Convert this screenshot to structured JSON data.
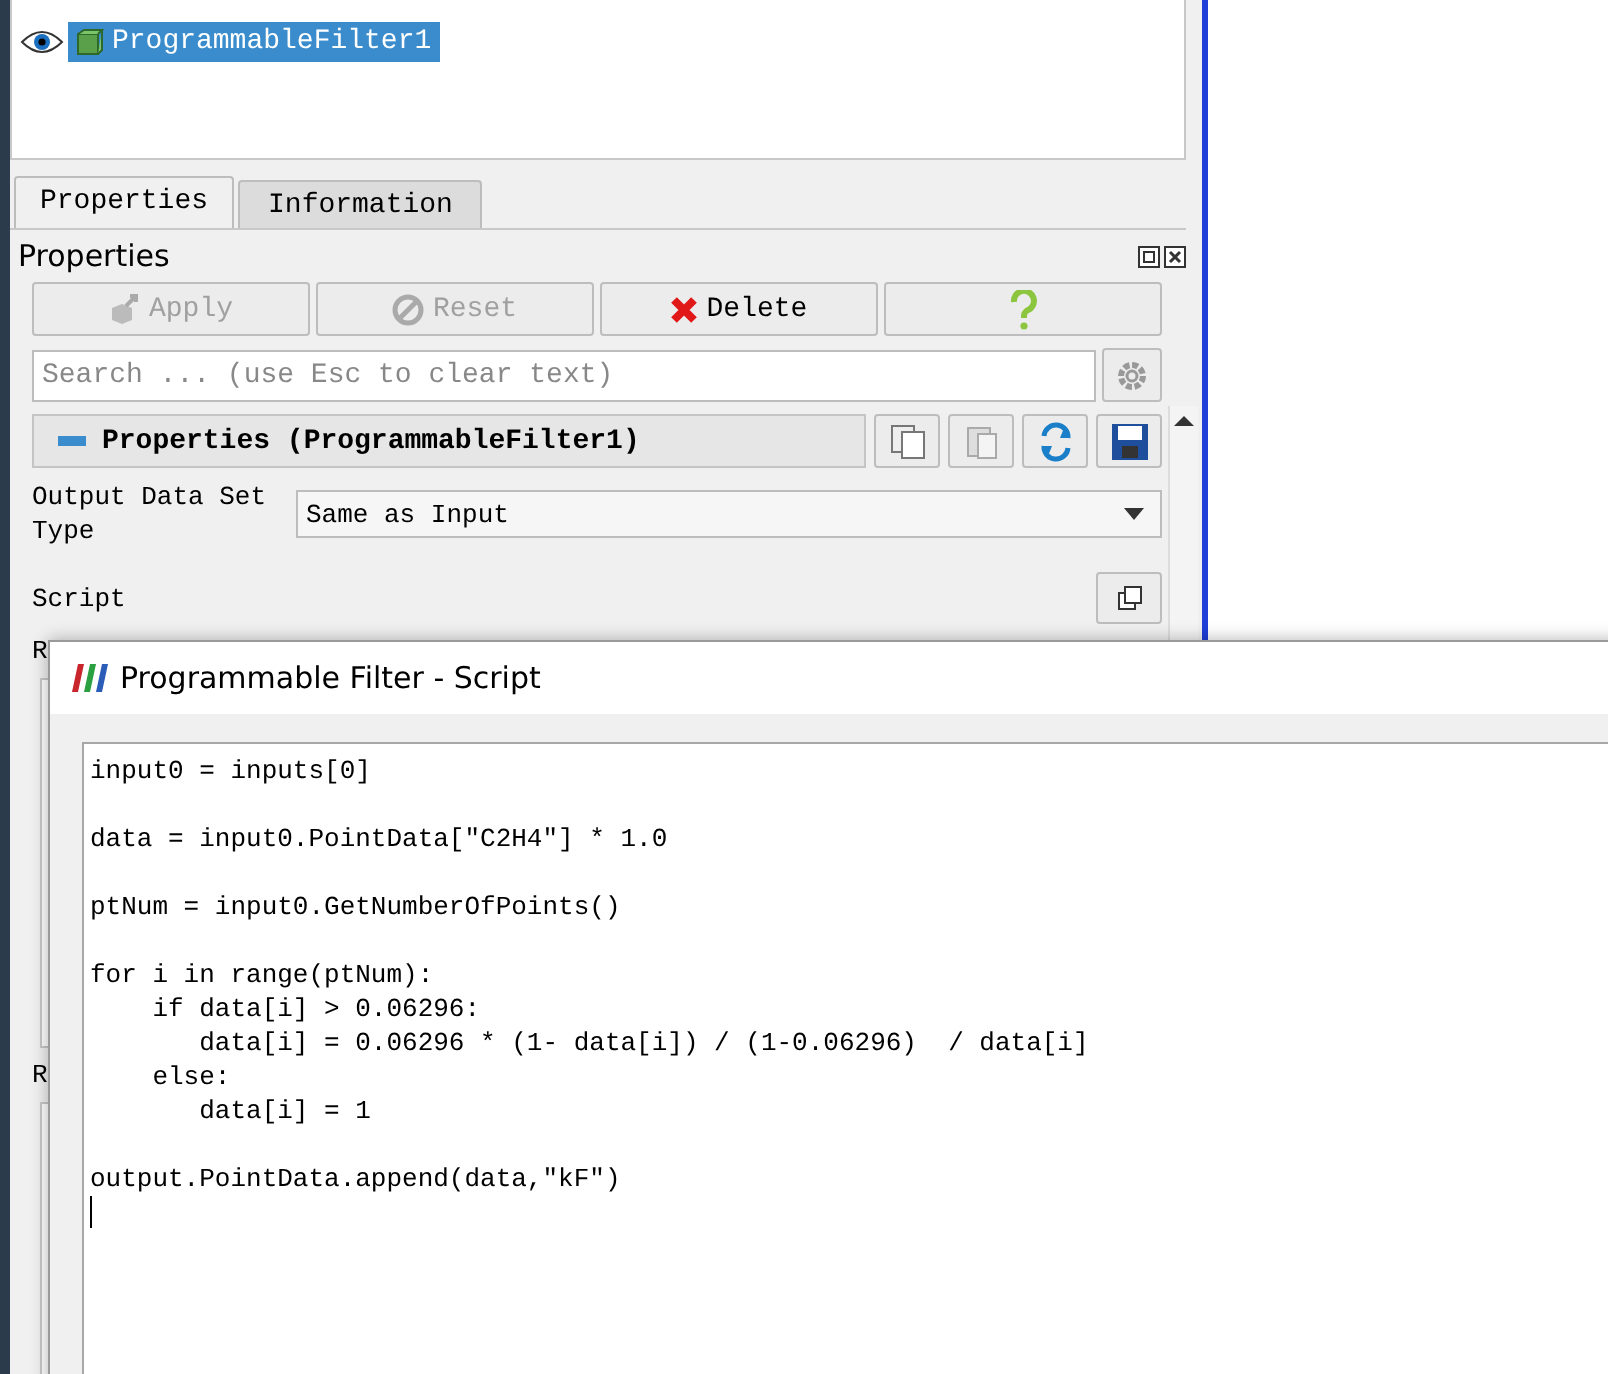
{
  "pipeline": {
    "items": [
      {
        "label": "ProgrammableFilter1",
        "visible": true,
        "selected": true
      }
    ]
  },
  "tabs": [
    {
      "label": "Properties",
      "selected": true
    },
    {
      "label": "Information",
      "selected": false
    }
  ],
  "panel": {
    "title": "Properties"
  },
  "buttons": [
    {
      "kind": "apply",
      "label": "Apply",
      "disabled": true
    },
    {
      "kind": "reset",
      "label": "Reset",
      "disabled": true
    },
    {
      "kind": "delete",
      "label": "Delete",
      "disabled": false
    },
    {
      "kind": "help"
    }
  ],
  "search": {
    "placeholder": "Search ... (use Esc to clear text)"
  },
  "section": {
    "title": "Properties (ProgrammableFilter1)",
    "expanded": true
  },
  "output_type": {
    "label": "Output Data Set Type",
    "value": "Same as Input"
  },
  "script": {
    "label": "Script"
  },
  "hidden_labels": [
    "R",
    "R"
  ],
  "dialog": {
    "title": "Programmable Filter - Script",
    "code": "input0 = inputs[0]\n\ndata = input0.PointData[\"C2H4\"] * 1.0\n\nptNum = input0.GetNumberOfPoints()\n\nfor i in range(ptNum):\n    if data[i] > 0.06296:\n       data[i] = 0.06296 * (1- data[i]) / (1-0.06296)  / data[i]\n    else:\n       data[i] = 1\n\noutput.PointData.append(data,\"kF\")"
  }
}
